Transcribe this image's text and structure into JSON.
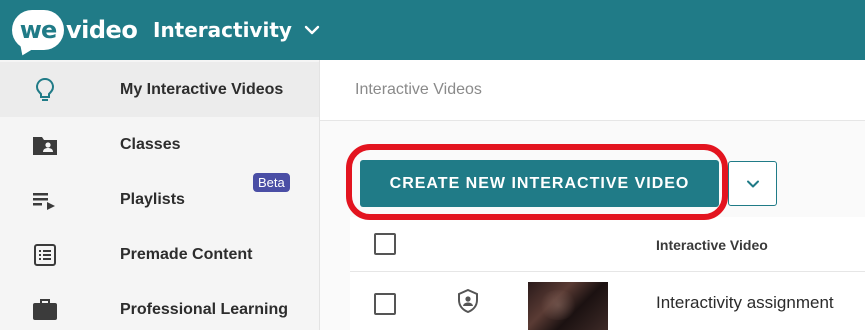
{
  "header": {
    "logo_we": "we",
    "logo_video": "video",
    "app_name": "Interactivity"
  },
  "sidebar": {
    "items": [
      {
        "label": "My Interactive Videos",
        "icon": "lightbulb-icon",
        "active": true
      },
      {
        "label": "Classes",
        "icon": "folder-user-icon",
        "active": false
      },
      {
        "label": "Playlists",
        "icon": "playlist-icon",
        "active": false
      },
      {
        "label": "Premade Content",
        "icon": "list-icon",
        "active": false,
        "badge": "Beta"
      },
      {
        "label": "Professional Learning",
        "icon": "briefcase-icon",
        "active": false
      }
    ]
  },
  "main": {
    "breadcrumb": "Interactive Videos",
    "create_button": "CREATE NEW INTERACTIVE VIDEO",
    "table": {
      "column_header": "Interactive Video",
      "rows": [
        {
          "title": "Interactivity assignment"
        }
      ]
    }
  },
  "colors": {
    "brand": "#207b87",
    "highlight": "#e3141f",
    "badge": "#4a4ea5"
  }
}
